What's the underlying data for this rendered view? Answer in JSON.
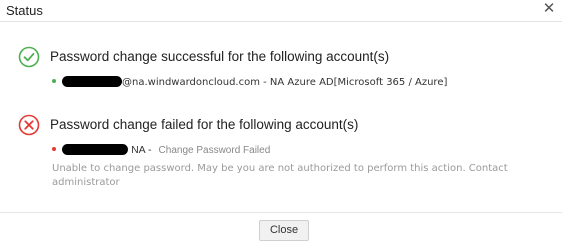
{
  "dialog": {
    "title": "Status",
    "close_icon_glyph": "✕"
  },
  "success_section": {
    "icon": "check-circle-icon",
    "icon_color": "#4caf50",
    "heading": "Password change successful for the following account(s)",
    "accounts": [
      {
        "username_redacted": true,
        "domain_text": "@na.windwardoncloud.com - NA Azure AD[Microsoft 365 / Azure]"
      }
    ]
  },
  "failed_section": {
    "icon": "x-circle-icon",
    "icon_color": "#e53935",
    "heading": "Password change failed for the following account(s)",
    "accounts": [
      {
        "username_redacted": true,
        "name_text": "NA -",
        "status_text": "Change Password Failed",
        "reason": "Unable to change password. May be you are not authorized to perform this action. Contact administrator"
      }
    ]
  },
  "footer": {
    "close_label": "Close"
  }
}
